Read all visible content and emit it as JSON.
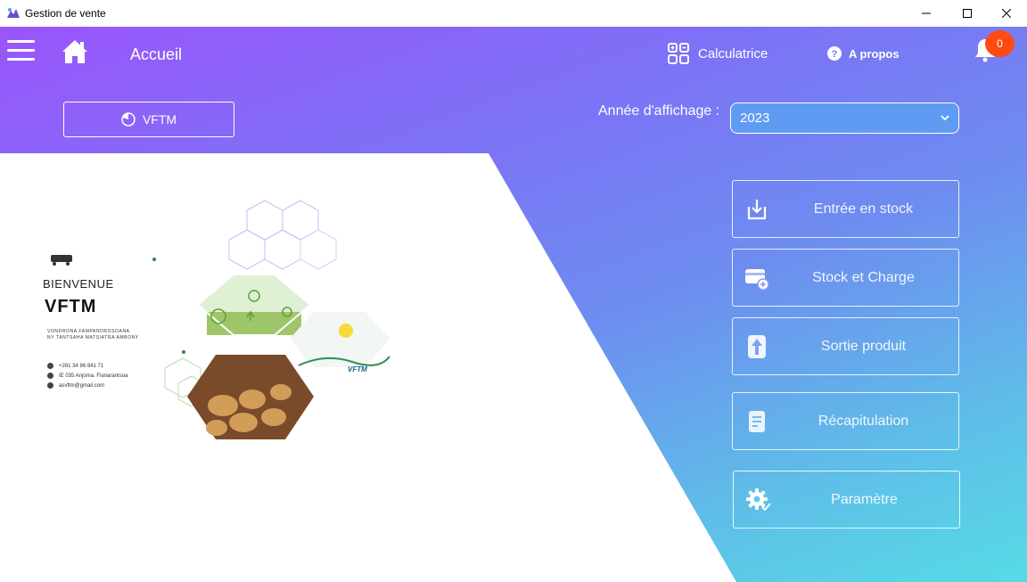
{
  "window": {
    "title": "Gestion de vente"
  },
  "header": {
    "page_title": "Accueil",
    "calculator_label": "Calculatrice",
    "about_label": "A propos",
    "notification_count": "0"
  },
  "company_button": {
    "label": "VFTM"
  },
  "year": {
    "label": "Année d'affichage :",
    "selected": "2023"
  },
  "actions": [
    {
      "label": "Entrée en stock",
      "icon": "download-icon"
    },
    {
      "label": "Stock et Charge",
      "icon": "card-add-icon"
    },
    {
      "label": "Sortie produit",
      "icon": "arrow-up-icon"
    },
    {
      "label": "Récapitulation",
      "icon": "document-icon"
    },
    {
      "label": "Paramètre",
      "icon": "gear-icon"
    }
  ],
  "poster": {
    "welcome": "BIENVENUE",
    "brand": "VFTM",
    "tagline_line1": "VONDRONA FAMPANDROSOANA",
    "tagline_line2": "NY TANTSAHA MATSIATRA AMBONY",
    "phone": "+261 34 86 841 71",
    "address": "IE 035 Anjoma. Fianarantsoa",
    "email": "asvftm@gmail.com",
    "logo_text": "VFTM"
  },
  "colors": {
    "gradient_top": "#9a55fb",
    "gradient_bottom": "#56dbe6",
    "badge": "#ff4a12"
  }
}
